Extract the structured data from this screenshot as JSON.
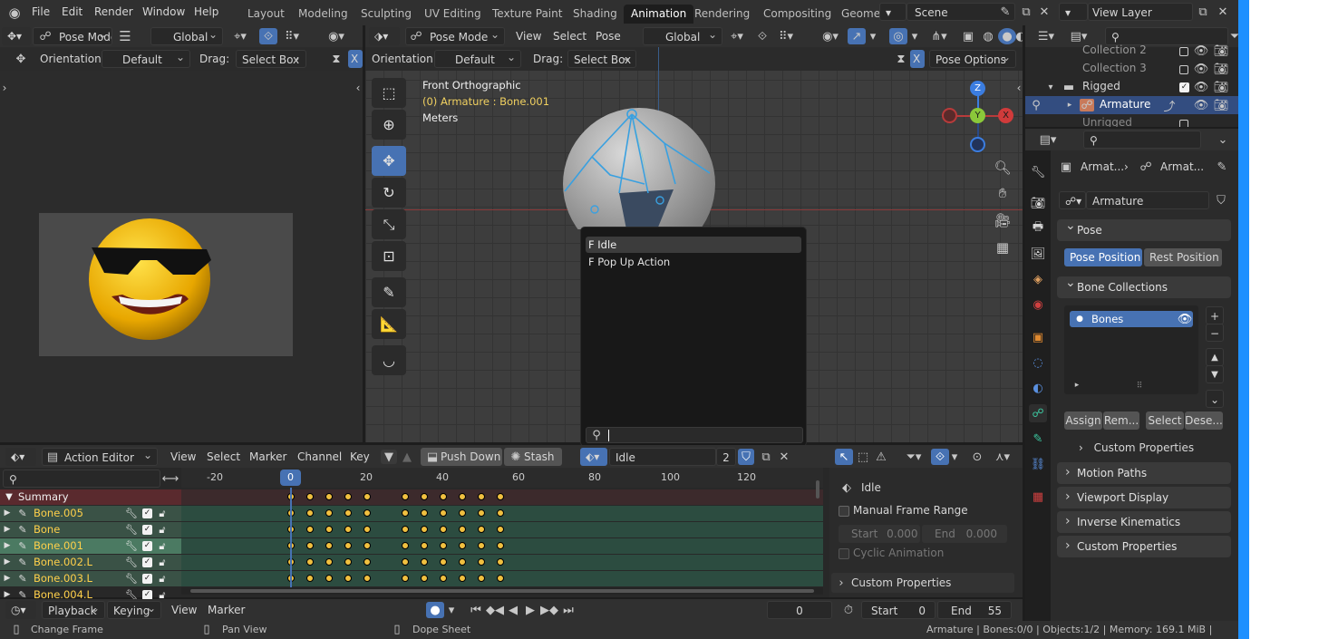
{
  "topbar": {
    "menus": [
      "File",
      "Edit",
      "Render",
      "Window",
      "Help"
    ],
    "workspaces": [
      "Layout",
      "Modeling",
      "Sculpting",
      "UV Editing",
      "Texture Paint",
      "Shading",
      "Animation",
      "Rendering",
      "Compositing",
      "Geome"
    ],
    "active_workspace": "Animation",
    "scene": "Scene",
    "view_layer": "View Layer"
  },
  "left_viewport": {
    "mode": "Pose Mode",
    "orientation_global": "Global",
    "orientation_label": "Orientation:",
    "orientation_value": "Default",
    "drag_label": "Drag:",
    "drag_value": "Select Box",
    "x_label": "X"
  },
  "main_viewport": {
    "mode": "Pose Mode",
    "menus": [
      "View",
      "Select",
      "Pose"
    ],
    "transform": "Global",
    "orientation_label": "Orientation:",
    "orientation_value": "Default",
    "drag_label": "Drag:",
    "drag_value": "Select Box",
    "pose_options": "Pose Options",
    "x_label": "X",
    "overlay_title": "Front Orthographic",
    "overlay_object": "(0) Armature : Bone.001",
    "overlay_units": "Meters",
    "gizmo": {
      "z": "Z",
      "y": "Y",
      "x": "X"
    }
  },
  "popup": {
    "items": [
      "F Idle",
      "F Pop Up Action"
    ],
    "search_value": ""
  },
  "outliner": {
    "rows": [
      {
        "label": "Collection 2"
      },
      {
        "label": "Collection 3"
      },
      {
        "label": "Rigged"
      },
      {
        "label": "Armature"
      },
      {
        "label": "Unrigged"
      }
    ]
  },
  "properties": {
    "breadcrumb_1": "Armat...",
    "breadcrumb_2": "Armat...",
    "object_name": "Armature",
    "pose_panel": "Pose",
    "pose_position": "Pose Position",
    "rest_position": "Rest Position",
    "bone_collections_panel": "Bone Collections",
    "bone_collection_item": "Bones",
    "assign": "Assign",
    "remove": "Rem...",
    "select": "Select",
    "deselect": "Dese...",
    "custom_properties_sub": "Custom Properties",
    "panels": [
      "Motion Paths",
      "Viewport Display",
      "Inverse Kinematics",
      "Custom Properties"
    ]
  },
  "dopesheet": {
    "editor_type": "Action Editor",
    "menus": [
      "View",
      "Select",
      "Marker",
      "Channel",
      "Key"
    ],
    "push_down": "Push Down",
    "stash": "Stash",
    "action_name": "Idle",
    "users": "2",
    "frame_ticks": [
      "-20",
      "0",
      "20",
      "40",
      "60",
      "80",
      "100",
      "120"
    ],
    "current_frame_marker": "0",
    "summary": "Summary",
    "channels": [
      "Bone.005",
      "Bone",
      "Bone.001",
      "Bone.002.L",
      "Bone.003.L",
      "Bone.004.L"
    ],
    "selected_channel": "Bone.001",
    "keyframes": [
      0,
      5,
      10,
      15,
      20,
      30,
      35,
      40,
      45,
      50,
      55
    ]
  },
  "action_panel": {
    "action_name": "Idle",
    "manual_frame_range": "Manual Frame Range",
    "start_label": "Start",
    "start_value": "0.000",
    "end_label": "End",
    "end_value": "0.000",
    "cyclic": "Cyclic Animation",
    "custom_properties": "Custom Properties"
  },
  "timeline": {
    "menus": [
      "Playback",
      "Keying",
      "View",
      "Marker"
    ],
    "current_frame": "0",
    "start_label": "Start",
    "start_value": "0",
    "end_label": "End",
    "end_value": "55"
  },
  "statusbar": {
    "hint_1": "Change Frame",
    "hint_2": "Pan View",
    "hint_3": "Dope Sheet",
    "stats": "Armature | Bones:0/0 | Objects:1/2 | Memory: 169.1 MiB | 4.0.2"
  },
  "colors": {
    "accent": "#4772b3",
    "keyframe": "#f0c040",
    "channel_bg": "#2c4c40",
    "playhead": "#4772b3"
  }
}
